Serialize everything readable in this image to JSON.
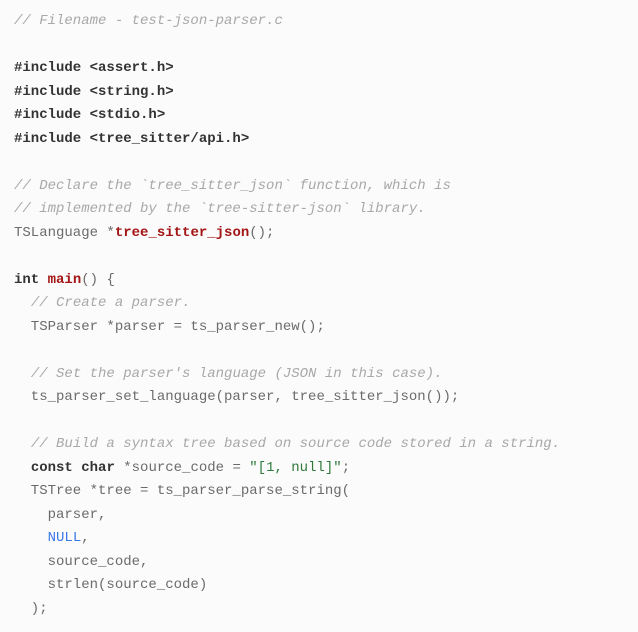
{
  "code": {
    "l1a": "// Filename - test-json-parser.c",
    "l3a": "#include <assert.h>",
    "l4a": "#include <string.h>",
    "l5a": "#include <stdio.h>",
    "l6a": "#include <tree_sitter/api.h>",
    "l8a": "// Declare the `tree_sitter_json` function, which is",
    "l9a": "// implemented by the `tree-sitter-json` library.",
    "l10a": "TSLanguage *",
    "l10b": "tree_sitter_json",
    "l10c": "();",
    "l12a": "int",
    "l12b": " ",
    "l12c": "main",
    "l12d": "() {",
    "l13a": "  ",
    "l13b": "// Create a parser.",
    "l14a": "  TSParser *parser = ts_parser_new();",
    "l16a": "  ",
    "l16b": "// Set the parser's language (JSON in this case).",
    "l17a": "  ts_parser_set_language(parser, tree_sitter_json());",
    "l19a": "  ",
    "l19b": "// Build a syntax tree based on source code stored in a string.",
    "l20a": "  ",
    "l20b": "const",
    "l20c": " ",
    "l20d": "char",
    "l20e": " *source_code = ",
    "l20f": "\"[1, null]\"",
    "l20g": ";",
    "l21a": "  TSTree *tree = ts_parser_parse_string(",
    "l22a": "    parser,",
    "l23a": "    ",
    "l23b": "NULL",
    "l23c": ",",
    "l24a": "    source_code,",
    "l25a": "    strlen(source_code)",
    "l26a": "  );"
  }
}
